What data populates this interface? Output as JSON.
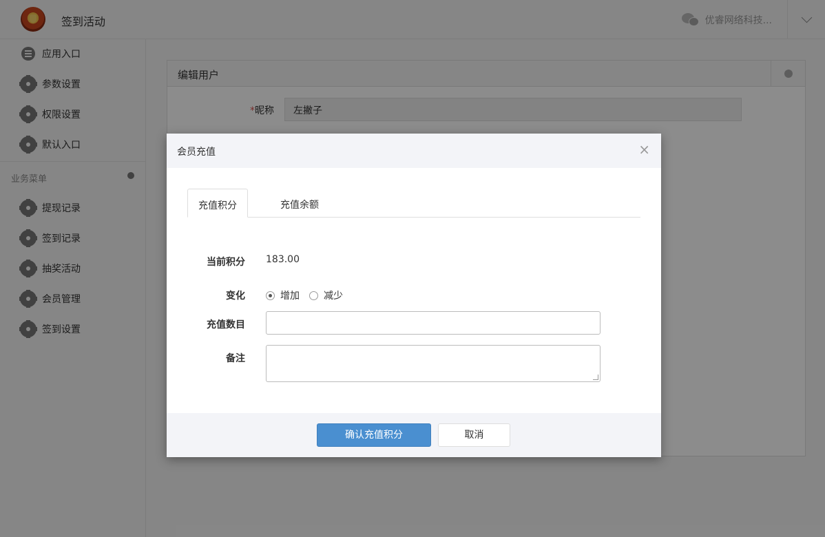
{
  "header": {
    "app_title": "签到活动",
    "org_name": "优睿网络科技...",
    "icons": {
      "logo": "app-logo",
      "wechat": "wechat-icon",
      "toggle": "chevron-down-icon"
    }
  },
  "sidebar": {
    "items": [
      {
        "label": "应用入口",
        "icon": "chat-icon"
      },
      {
        "label": "参数设置",
        "icon": "gear-icon"
      },
      {
        "label": "权限设置",
        "icon": "gear-icon"
      },
      {
        "label": "默认入口",
        "icon": "gear-icon"
      }
    ],
    "section_title": "业务菜单",
    "business_items": [
      {
        "label": "提现记录",
        "icon": "gear-icon"
      },
      {
        "label": "签到记录",
        "icon": "gear-icon"
      },
      {
        "label": "抽奖活动",
        "icon": "gear-icon"
      },
      {
        "label": "会员管理",
        "icon": "gear-icon"
      },
      {
        "label": "签到设置",
        "icon": "gear-icon"
      }
    ]
  },
  "panel": {
    "title": "编辑用户",
    "nickname_label": "昵称",
    "required_mark": "*",
    "nickname_value": "左撇子"
  },
  "modal": {
    "title": "会员充值",
    "close": "×",
    "tabs": [
      {
        "label": "充值积分",
        "active": true
      },
      {
        "label": "充值余额",
        "active": false
      }
    ],
    "current_points_label": "当前积分",
    "current_points_value": "183.00",
    "change_label": "变化",
    "change_options": [
      {
        "label": "增加",
        "checked": true
      },
      {
        "label": "减少",
        "checked": false
      }
    ],
    "amount_label": "充值数目",
    "amount_value": "",
    "remark_label": "备注",
    "remark_value": "",
    "confirm_button": "确认充值积分",
    "cancel_button": "取消"
  },
  "colors": {
    "primary": "#4a8fd0",
    "required": "#d9534f"
  }
}
